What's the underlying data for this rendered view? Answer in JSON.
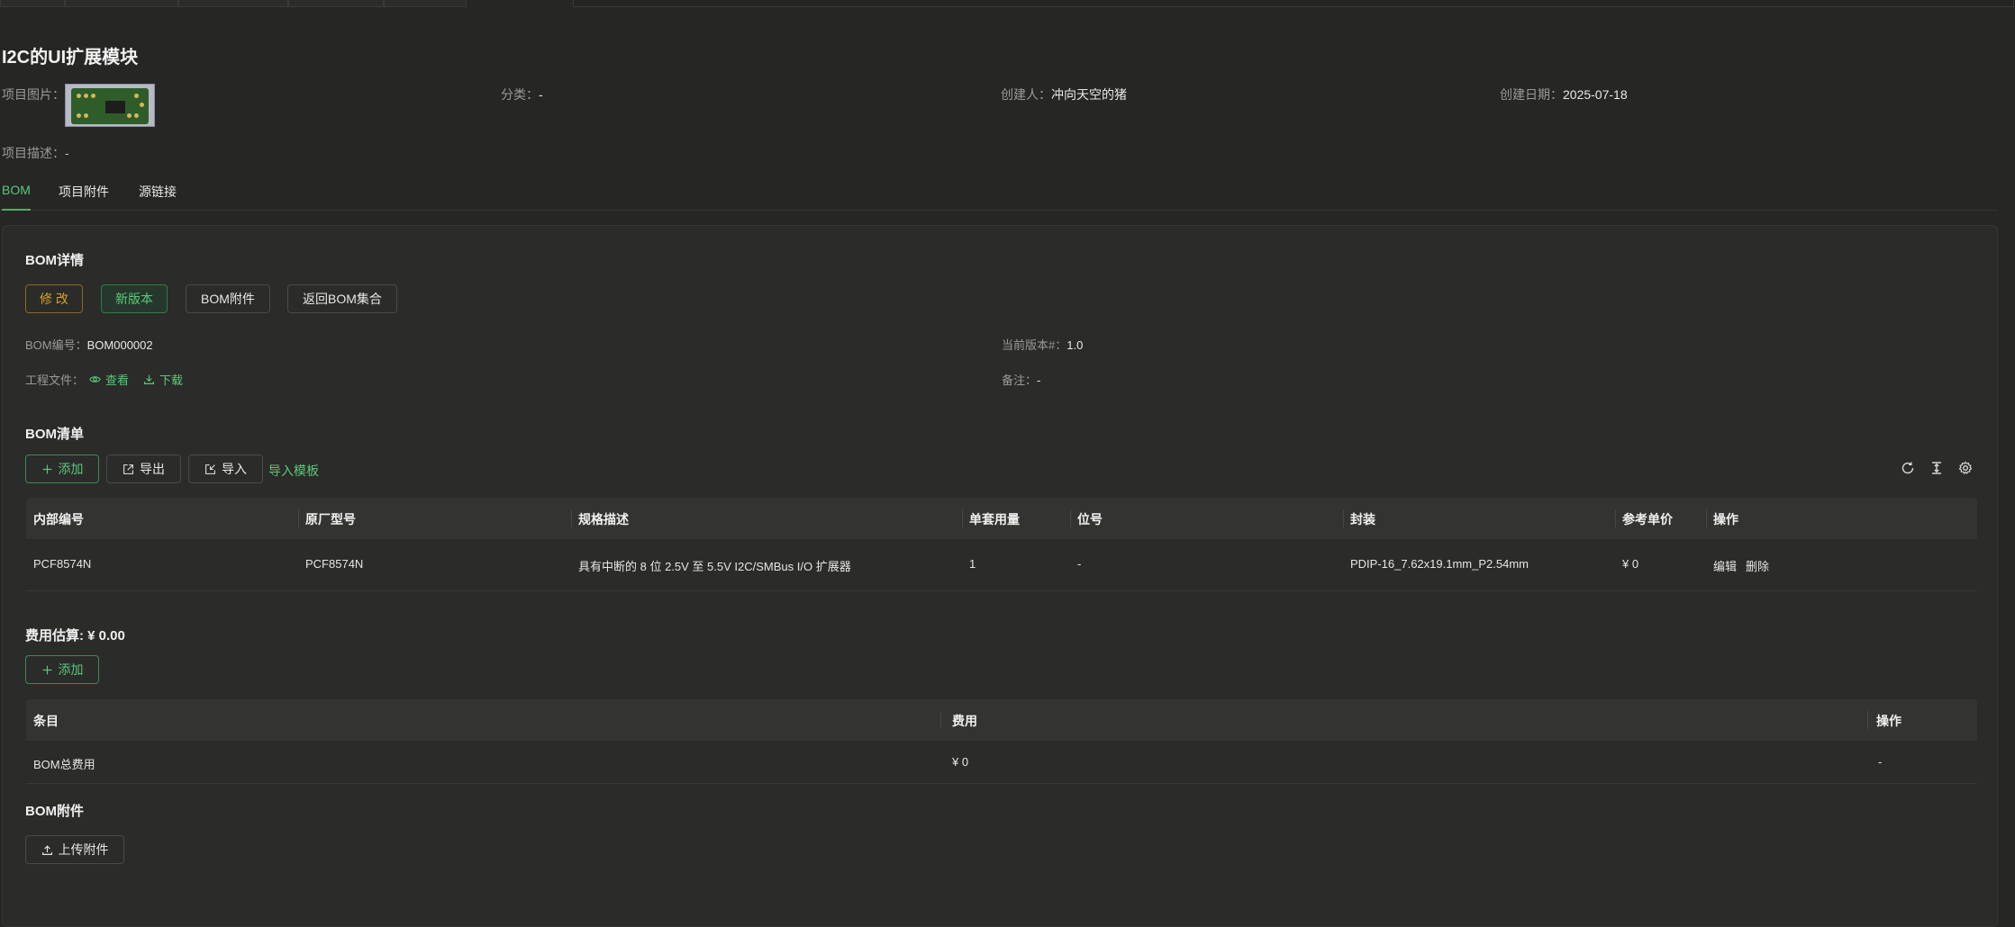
{
  "project": {
    "title": "I2C的UI扩展模块",
    "image_label": "项目图片：",
    "category_label": "分类：",
    "category_value": "-",
    "creator_label": "创建人：",
    "creator_value": "冲向天空的猪",
    "date_label": "创建日期：",
    "date_value": "2025-07-18",
    "desc_label": "项目描述：",
    "desc_value": "-"
  },
  "tabs": [
    {
      "label": "BOM",
      "active": true
    },
    {
      "label": "项目附件",
      "active": false
    },
    {
      "label": "源链接",
      "active": false
    }
  ],
  "bom_detail": {
    "title": "BOM详情",
    "buttons": {
      "edit": "修 改",
      "new_version": "新版本",
      "attachments": "BOM附件",
      "back": "返回BOM集合"
    },
    "number_label": "BOM编号：",
    "number_value": "BOM000002",
    "version_label": "当前版本#：",
    "version_value": "1.0",
    "files_label": "工程文件：",
    "view_label": "查看",
    "download_label": "下载",
    "remark_label": "备注：",
    "remark_value": "-"
  },
  "bom_list": {
    "title": "BOM清单",
    "toolbar": {
      "add": "添加",
      "export": "导出",
      "import": "导入",
      "import_template": "导入模板"
    },
    "columns": [
      "内部编号",
      "原厂型号",
      "规格描述",
      "单套用量",
      "位号",
      "封装",
      "参考单价",
      "操作"
    ],
    "rows": [
      {
        "internal_no": "PCF8574N",
        "model": "PCF8574N",
        "spec": "具有中断的 8 位 2.5V 至 5.5V I2C/SMBus I/O 扩展器",
        "qty": "1",
        "designator": "-",
        "package": "PDIP-16_7.62x19.1mm_P2.54mm",
        "price": "¥ 0",
        "edit": "编辑",
        "delete": "删除"
      }
    ]
  },
  "cost": {
    "title": "费用估算: ¥ 0.00",
    "add": "添加",
    "columns": [
      "条目",
      "费用",
      "操作"
    ],
    "rows": [
      {
        "item": "BOM总费用",
        "fee": "¥ 0",
        "action": "-"
      }
    ]
  },
  "attachments": {
    "title": "BOM附件",
    "upload": "上传附件"
  },
  "colors": {
    "background": "#262624",
    "accent_green": "#5cc77a",
    "warning_orange": "#d9a22a",
    "danger_red": "#e0514a"
  },
  "icons": [
    "eye-icon",
    "download-icon",
    "plus-icon",
    "export-icon",
    "import-icon",
    "refresh-icon",
    "column-height-icon",
    "settings-icon",
    "upload-icon"
  ]
}
